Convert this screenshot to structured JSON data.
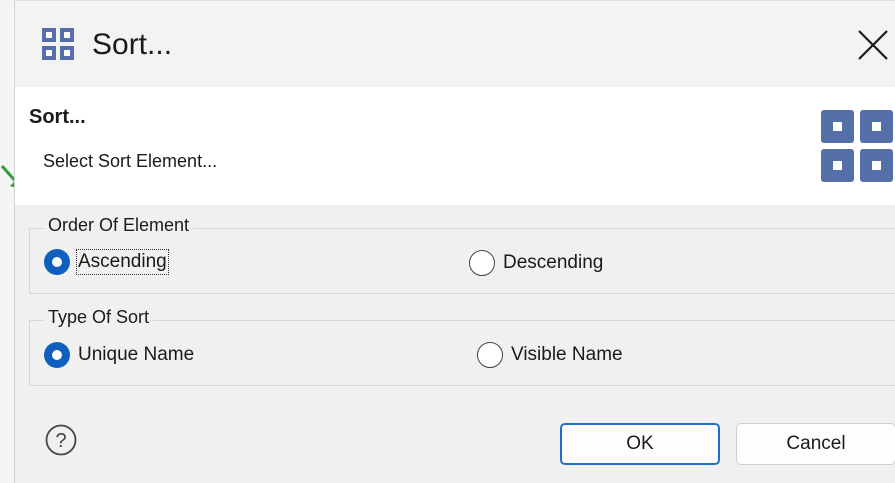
{
  "window": {
    "title": "Sort...",
    "close_glyph": "✕"
  },
  "banner": {
    "title": "Sort...",
    "subtitle": "Select Sort Element..."
  },
  "order_group": {
    "legend": "Order Of Element",
    "options": [
      {
        "label": "Ascending",
        "checked": true
      },
      {
        "label": "Descending",
        "checked": false
      }
    ]
  },
  "type_group": {
    "legend": "Type Of Sort",
    "options": [
      {
        "label": "Unique Name",
        "checked": true
      },
      {
        "label": "Visible Name",
        "checked": false
      }
    ]
  },
  "buttons": {
    "ok": "OK",
    "cancel": "Cancel"
  },
  "icons": {
    "title": "grid-icon",
    "banner": "grid-icon",
    "help": "help-icon",
    "close": "close-icon",
    "pointer": "arrow-icon"
  },
  "colors": {
    "accent": "#0f5fbf",
    "grid_icon": "#5570a8",
    "arrow": "#2e9e3e"
  }
}
